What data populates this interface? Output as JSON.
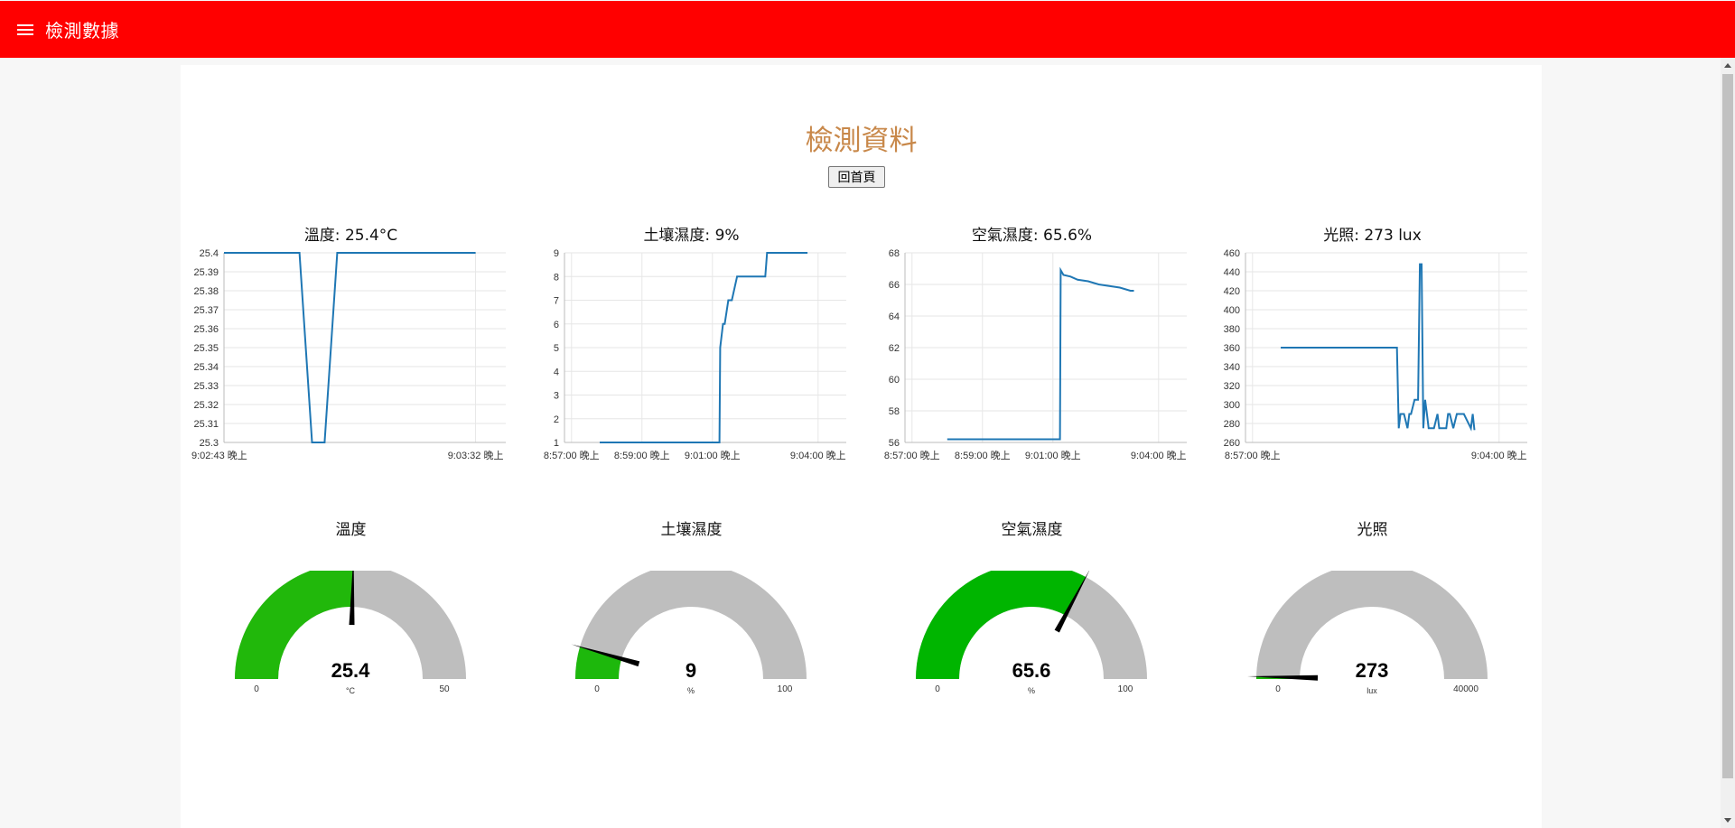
{
  "header": {
    "title": "檢測數據",
    "menu_icon": "hamburger-menu-icon",
    "color": "#ff0000"
  },
  "page": {
    "title": "檢測資料",
    "home_button": "回首頁"
  },
  "chart_data": [
    {
      "type": "line",
      "title": "溫度: 25.4°C",
      "ylim": [
        25.3,
        25.4
      ],
      "yticks": [
        "25.4",
        "25.39",
        "25.38",
        "25.37",
        "25.36",
        "25.35",
        "25.34",
        "25.33",
        "25.32",
        "25.31",
        "25.3"
      ],
      "xtick_labels": [
        "9:02:43 晚上",
        "9:03:32 晚上"
      ],
      "xtick_pos": [
        0,
        1
      ],
      "xrange": [
        0,
        1.12
      ],
      "x": [
        0.0,
        0.3,
        0.35,
        0.4,
        0.45,
        1.0
      ],
      "y": [
        25.4,
        25.4,
        25.3,
        25.3,
        25.4,
        25.4
      ],
      "color": "#1f77b4"
    },
    {
      "type": "line",
      "title": "土壤濕度: 9%",
      "ylim": [
        1,
        9
      ],
      "yticks": [
        "9",
        "8",
        "7",
        "6",
        "5",
        "4",
        "3",
        "2",
        "1"
      ],
      "xtick_labels": [
        "8:57:00 晚上",
        "8:59:00 晚上",
        "9:01:00 晚上",
        "9:04:00 晚上"
      ],
      "xtick_pos": [
        0,
        2,
        4,
        7
      ],
      "xrange": [
        -0.2,
        7.8
      ],
      "x": [
        0.8,
        4.2,
        4.22,
        4.3,
        4.35,
        4.45,
        4.55,
        4.7,
        5.5,
        5.55,
        6.7
      ],
      "y": [
        1,
        1,
        5,
        6,
        6,
        7,
        7,
        8,
        8,
        9,
        9
      ],
      "color": "#1f77b4"
    },
    {
      "type": "line",
      "title": "空氣濕度: 65.6%",
      "ylim": [
        56,
        68
      ],
      "yticks": [
        "68",
        "66",
        "64",
        "62",
        "60",
        "58",
        "56"
      ],
      "xtick_labels": [
        "8:57:00 晚上",
        "8:59:00 晚上",
        "9:01:00 晚上",
        "9:04:00 晚上"
      ],
      "xtick_pos": [
        0,
        2,
        4,
        7
      ],
      "xrange": [
        -0.2,
        7.8
      ],
      "x": [
        1.0,
        4.2,
        4.22,
        4.3,
        4.5,
        4.7,
        5.0,
        5.3,
        5.6,
        5.9,
        6.2,
        6.3
      ],
      "y": [
        56.2,
        56.2,
        66.9,
        66.6,
        66.5,
        66.3,
        66.2,
        66.0,
        65.9,
        65.8,
        65.6,
        65.6
      ],
      "color": "#1f77b4"
    },
    {
      "type": "line",
      "title": "光照: 273 lux",
      "ylim": [
        260,
        460
      ],
      "yticks": [
        "460",
        "440",
        "420",
        "400",
        "380",
        "360",
        "340",
        "320",
        "300",
        "280",
        "260"
      ],
      "xtick_labels": [
        "8:57:00 晚上",
        "9:04:00 晚上"
      ],
      "xtick_pos": [
        0,
        7
      ],
      "xrange": [
        -0.2,
        7.8
      ],
      "x": [
        0.8,
        4.1,
        4.15,
        4.2,
        4.3,
        4.4,
        4.45,
        4.5,
        4.6,
        4.7,
        4.75,
        4.8,
        4.85,
        4.9,
        4.95,
        5.0,
        5.05,
        5.15,
        5.25,
        5.3,
        5.35,
        5.5,
        5.55,
        5.6,
        5.7,
        5.8,
        5.95,
        6.0,
        6.2,
        6.25,
        6.3
      ],
      "y": [
        360,
        360,
        275,
        290,
        290,
        275,
        290,
        290,
        305,
        305,
        448,
        448,
        275,
        305,
        290,
        275,
        275,
        275,
        290,
        275,
        275,
        275,
        290,
        290,
        275,
        290,
        290,
        290,
        275,
        290,
        273
      ],
      "color": "#1f77b4"
    }
  ],
  "gauges": [
    {
      "title": "溫度",
      "value": 25.4,
      "display": "25.4",
      "unit": "°C",
      "min": 0,
      "max": 50,
      "min_label": "0",
      "max_label": "50",
      "color": "#21b80b"
    },
    {
      "title": "土壤濕度",
      "value": 9,
      "display": "9",
      "unit": "%",
      "min": 0,
      "max": 100,
      "min_label": "0",
      "max_label": "100",
      "color": "#1db80c"
    },
    {
      "title": "空氣濕度",
      "value": 65.6,
      "display": "65.6",
      "unit": "%",
      "min": 0,
      "max": 100,
      "min_label": "0",
      "max_label": "100",
      "color": "#00b500"
    },
    {
      "title": "光照",
      "value": 273,
      "display": "273",
      "unit": "lux",
      "min": 0,
      "max": 40000,
      "min_label": "0",
      "max_label": "40000",
      "color": "#1db80c"
    }
  ]
}
